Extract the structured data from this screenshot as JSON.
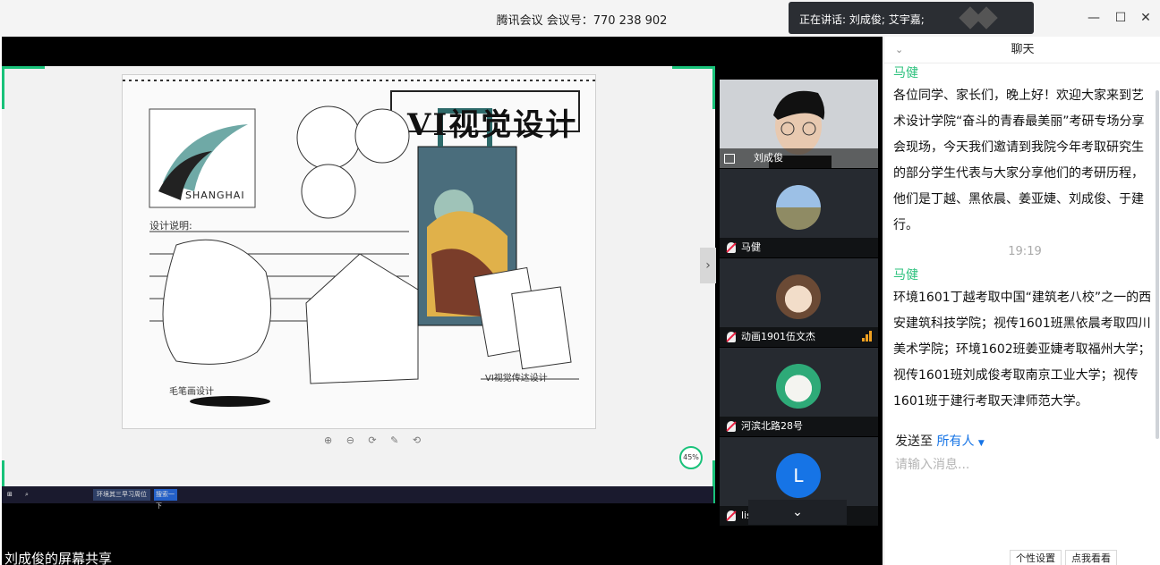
{
  "titlebar": {
    "title": "腾讯会议 会议号：770 238 902",
    "speaking": "正在讲话: 刘成俊; 艾宇嘉;",
    "minimize": "—",
    "maximize": "☐",
    "close": "✕"
  },
  "share": {
    "artwork_title": "VI视觉设计",
    "artwork_shanghai": "SHANGHAI",
    "artwork_note1": "设计说明:",
    "artwork_note2": "毛笔画设计",
    "artwork_note3": "VI视觉传达设计",
    "zoom_controls": "⊕ ⊖ ⟳ ✎ ⟲",
    "zoom_percent": "45%",
    "taskbar_items": [
      "环境其三早习周位",
      "搜索一下"
    ],
    "label": "刘成俊的屏幕共享",
    "collapse": "›"
  },
  "participants": [
    {
      "name": "刘成俊",
      "type": "video"
    },
    {
      "name": "马健",
      "type": "avatar",
      "color": "#6c8fb7"
    },
    {
      "name": "动画1901伍文杰",
      "type": "avatar",
      "color": "#d9c7b8"
    },
    {
      "name": "河滨北路28号",
      "type": "avatar",
      "color": "#cfe7d8"
    },
    {
      "name": "lisijie",
      "type": "letter",
      "letter": "L",
      "color": "#1674e6"
    }
  ],
  "panel_down": "⌄",
  "chat": {
    "header": "聊天",
    "messages": [
      {
        "sender": "马健",
        "text": "各位同学、家长们，晚上好！欢迎大家来到艺术设计学院“奋斗的青春最美丽”考研专场分享会现场，今天我们邀请到我院今年考取研究生的部分学生代表与大家分享他们的考研历程，他们是丁越、黑依晨、姜亚婕、刘成俊、于建行。"
      },
      {
        "time": "19:19"
      },
      {
        "sender": "马健",
        "text": "环境1601丁越考取中国“建筑老八校”之一的西安建筑科技学院；视传1601班黑依晨考取四川美术学院；环境1602班姜亚婕考取福州大学；视传1601班刘成俊考取南京工业大学；视传1601班于建行考取天津师范大学。"
      }
    ],
    "send_to": "发送至",
    "send_target": "所有人",
    "input_placeholder": "请输入消息...",
    "bottom_buttons": [
      "个性设置",
      "点我看看"
    ]
  }
}
